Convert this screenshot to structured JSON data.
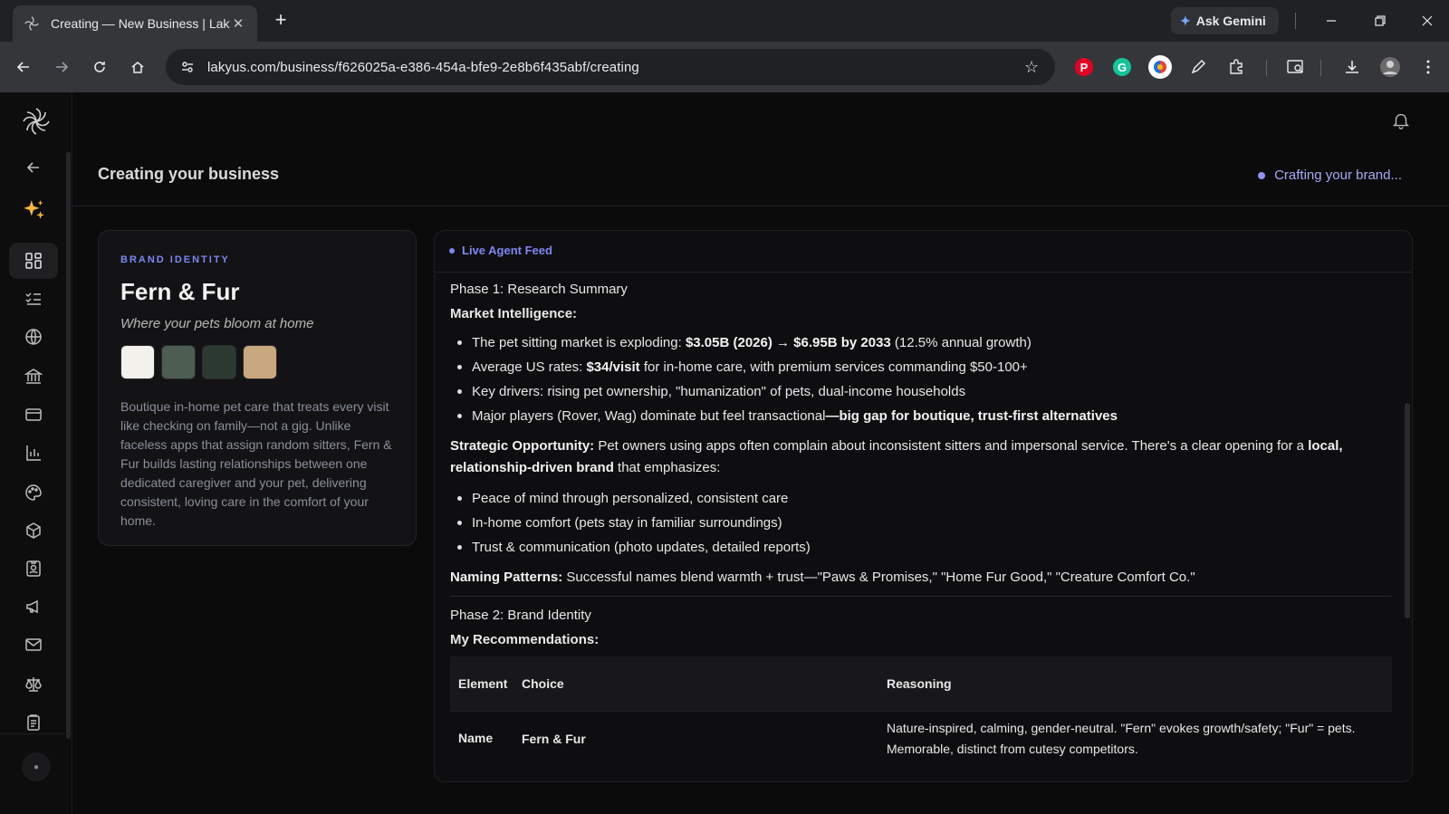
{
  "browser": {
    "tab_title": "Creating — New Business | Lakyus",
    "new_tab_symbol": "+",
    "close_symbol": "✕",
    "ask_gemini": "Ask Gemini",
    "url": "lakyus.com/business/f626025a-e386-454a-bfe9-2e8b6f435abf/creating"
  },
  "header": {
    "title": "Creating your business",
    "status": "Crafting your brand..."
  },
  "brand": {
    "eyebrow": "BRAND IDENTITY",
    "name": "Fern & Fur",
    "tagline": "Where your pets bloom at home",
    "palette": [
      "#f3f1ec",
      "#4d5d52",
      "#2c3a31",
      "#c9a77f"
    ],
    "description": "Boutique in-home pet care that treats every visit like checking on family—not a gig. Unlike faceless apps that assign random sitters, Fern & Fur builds lasting relationships between one dedicated caregiver and your pet, delivering consistent, loving care in the comfort of your home."
  },
  "feed": {
    "label": "Live Agent Feed",
    "phase1": "Phase 1: Research Summary",
    "market_heading": "Market Intelligence:",
    "market_1_pre": "The pet sitting market is exploding: ",
    "market_1_bold": "$3.05B (2026) → $6.95B by 2033",
    "market_1_post": " (12.5% annual growth)",
    "market_2_pre": "Average US rates: ",
    "market_2_bold": "$34/visit",
    "market_2_post": " for in-home care, with premium services commanding $50-100+",
    "market_3": "Key drivers: rising pet ownership, \"humanization\" of pets, dual-income households",
    "market_4_pre": "Major players (Rover, Wag) dominate but feel transactional",
    "market_4_bold": "—big gap for boutique, trust-first alternatives",
    "strategic_bold": "Strategic Opportunity:",
    "strategic_text": " Pet owners using apps often complain about inconsistent sitters and impersonal service. There's a clear opening for a ",
    "strategic_bold2": "local, relationship-driven brand",
    "strategic_text2": " that emphasizes:",
    "opp_1": "Peace of mind through personalized, consistent care",
    "opp_2": "In-home comfort (pets stay in familiar surroundings)",
    "opp_3": "Trust & communication (photo updates, detailed reports)",
    "naming_bold": "Naming Patterns:",
    "naming_text": " Successful names blend warmth + trust—\"Paws & Promises,\" \"Home Fur Good,\" \"Creature Comfort Co.\"",
    "phase2": "Phase 2: Brand Identity",
    "recommend_heading": "My Recommendations:",
    "table": {
      "headers": [
        "Element",
        "Choice",
        "Reasoning"
      ],
      "rows": [
        [
          "Name",
          "Fern & Fur",
          "Nature-inspired, calming, gender-neutral. \"Fern\" evokes growth/safety; \"Fur\" = pets. Memorable, distinct from cutesy competitors."
        ]
      ]
    }
  },
  "colors": {
    "accent": "#7f86f2",
    "status": "#a5aaf5",
    "background": "#0b0b0c"
  }
}
